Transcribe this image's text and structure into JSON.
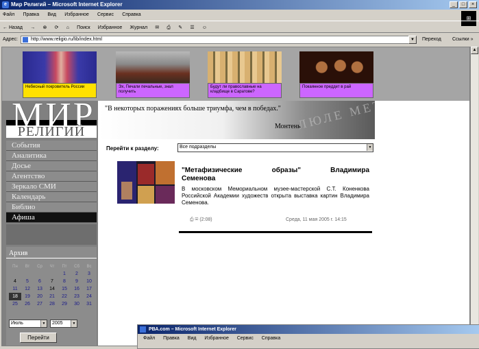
{
  "window": {
    "title": "Мир Религий – Microsoft Internet Explorer",
    "controls": [
      "_",
      "□",
      "×"
    ]
  },
  "menubar": [
    "Файл",
    "Правка",
    "Вид",
    "Избранное",
    "Сервис",
    "Справка"
  ],
  "toolbar": [
    "← Назад",
    "→",
    "⊗",
    "⟳",
    "⌂",
    "Поиск",
    "Избранное",
    "Журнал",
    "✉",
    "⎙",
    "✎",
    "☰",
    "☺"
  ],
  "address": {
    "label": "Адрес:",
    "url": "http://www.religio.ru/lib/index.html",
    "go_label": "Переход",
    "links_label": "Ссылки »"
  },
  "banner": {
    "items": [
      {
        "caption": "Небесный покровитель России",
        "caption_bg": "#ffe100",
        "colors": [
          "#2a2a90",
          "#c84a60"
        ]
      },
      {
        "caption": "Эх, Печали печальные, знал получить",
        "caption_bg": "#cc66ff",
        "colors": [
          "#6a3020",
          "#9a9a9a"
        ]
      },
      {
        "caption": "Будут ли православные на кладбище в Саратове?",
        "caption_bg": "#cc66ff",
        "colors": [
          "#d8b070",
          "#7a6a40"
        ]
      },
      {
        "caption": "Покаянное преддет в рай",
        "caption_bg": "#cc66ff",
        "colors": [
          "#2a1008",
          "#b07040"
        ]
      }
    ]
  },
  "logo": {
    "main": "МИР",
    "sub": "РЕЛИГИЙ"
  },
  "nav": {
    "items": [
      {
        "label": "События",
        "active": false
      },
      {
        "label": "Аналитика",
        "active": false
      },
      {
        "label": "Досье",
        "active": false
      },
      {
        "label": "Агентство",
        "active": false
      },
      {
        "label": "Зеркало СМИ",
        "active": false
      },
      {
        "label": "Календарь",
        "active": false
      },
      {
        "label": "Библио",
        "active": false
      },
      {
        "label": "Афиша",
        "active": true
      }
    ]
  },
  "archive": {
    "title": "Архив",
    "weekdays": [
      "Пн",
      "Вт",
      "Ср",
      "Чт",
      "Пт",
      "Сб",
      "Вс"
    ],
    "weeks": [
      [
        "",
        "",
        "",
        "",
        "1",
        "2",
        "3"
      ],
      [
        "4",
        "5",
        "6",
        "7",
        "8",
        "9",
        "10"
      ],
      [
        "11",
        "12",
        "13",
        "14",
        "15",
        "16",
        "17"
      ],
      [
        "18",
        "19",
        "20",
        "21",
        "22",
        "23",
        "24"
      ],
      [
        "25",
        "26",
        "27",
        "28",
        "29",
        "30",
        "31"
      ]
    ],
    "today": "18",
    "month": "Июль",
    "year": "2005",
    "button": "Перейти"
  },
  "quote": {
    "text": "\"В некоторых поражениях больше триумфа, чем в победах.\"",
    "author": "Монтень",
    "deco": "ЛЮЛЕ МЕТУ"
  },
  "goto": {
    "label": "Перейти к разделу:",
    "value": "Все подразделы"
  },
  "article": {
    "title_line1": "\"Метафизические образы\" Владимира",
    "title_line2": "Семенова",
    "body": "В московском Мемориальном музее-мастерской С.Т. Коненкова Российской Академии художеств открыта выставка картин Владимира Семенова.",
    "meta": "⎙ ✉ (2:08)",
    "date": "Среда, 11 мая 2005 г. 14:15"
  },
  "window2": {
    "title": "РВА.com – Microsoft Internet Explorer",
    "menu": [
      "Файл",
      "Правка",
      "Вид",
      "Избранное",
      "Сервис",
      "Справка"
    ]
  }
}
